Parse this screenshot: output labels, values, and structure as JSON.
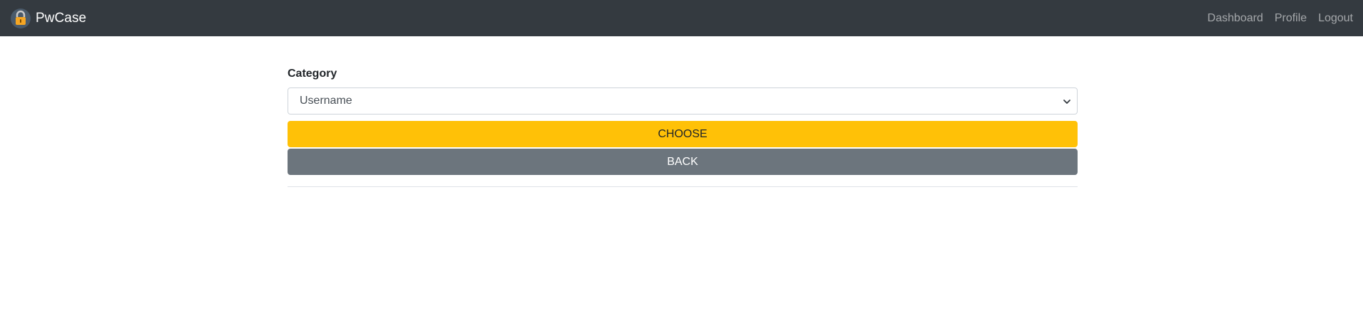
{
  "navbar": {
    "brand_name": "PwCase",
    "brand_icon": "padlock-icon",
    "links": [
      {
        "label": "Dashboard"
      },
      {
        "label": "Profile"
      },
      {
        "label": "Logout"
      }
    ],
    "background_color": "#343a40"
  },
  "form": {
    "category_label": "Category",
    "category_select": {
      "selected": "Username",
      "icon": "chevron-down-icon"
    },
    "choose_button": "CHOOSE",
    "back_button": "BACK"
  },
  "colors": {
    "choose": "#ffc107",
    "back": "#6c757d"
  }
}
